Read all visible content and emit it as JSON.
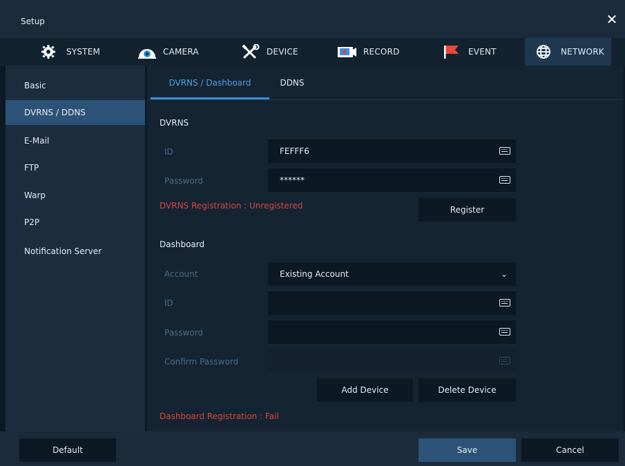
{
  "window": {
    "title": "Setup",
    "close_icon": "close-icon"
  },
  "tabs": [
    {
      "label": "SYSTEM",
      "icon": "gear-icon"
    },
    {
      "label": "CAMERA",
      "icon": "camera-icon"
    },
    {
      "label": "DEVICE",
      "icon": "tools-icon"
    },
    {
      "label": "RECORD",
      "icon": "record-icon"
    },
    {
      "label": "EVENT",
      "icon": "flag-icon"
    },
    {
      "label": "NETWORK",
      "icon": "globe-icon",
      "active": true
    }
  ],
  "sidebar": {
    "items": [
      {
        "label": "Basic"
      },
      {
        "label": "DVRNS / DDNS",
        "active": true
      },
      {
        "label": "E-Mail"
      },
      {
        "label": "FTP"
      },
      {
        "label": "Warp"
      },
      {
        "label": "P2P"
      },
      {
        "label": "Notification Server"
      }
    ]
  },
  "subtabs": [
    {
      "label": "DVRNS / Dashboard",
      "active": true
    },
    {
      "label": "DDNS"
    }
  ],
  "dvrns": {
    "section_title": "DVRNS",
    "id_label": "ID",
    "id_value": "FEFFF6",
    "password_label": "Password",
    "password_value": "******",
    "registration_status": "DVRNS Registration : Unregistered",
    "register_button": "Register"
  },
  "dashboard": {
    "section_title": "Dashboard",
    "account_label": "Account",
    "account_value": "Existing Account",
    "id_label": "ID",
    "id_value": "",
    "password_label": "Password",
    "password_value": "",
    "confirm_password_label": "Confirm Password",
    "confirm_password_value": "",
    "add_device_button": "Add Device",
    "delete_device_button": "Delete Device",
    "registration_status": "Dashboard Registration : Fail"
  },
  "footer": {
    "default_button": "Default",
    "save_button": "Save",
    "cancel_button": "Cancel"
  },
  "colors": {
    "accent": "#3a8fd8",
    "active_bg": "#2d5277",
    "error": "#d8453d",
    "muted_label": "#4d6b88"
  }
}
